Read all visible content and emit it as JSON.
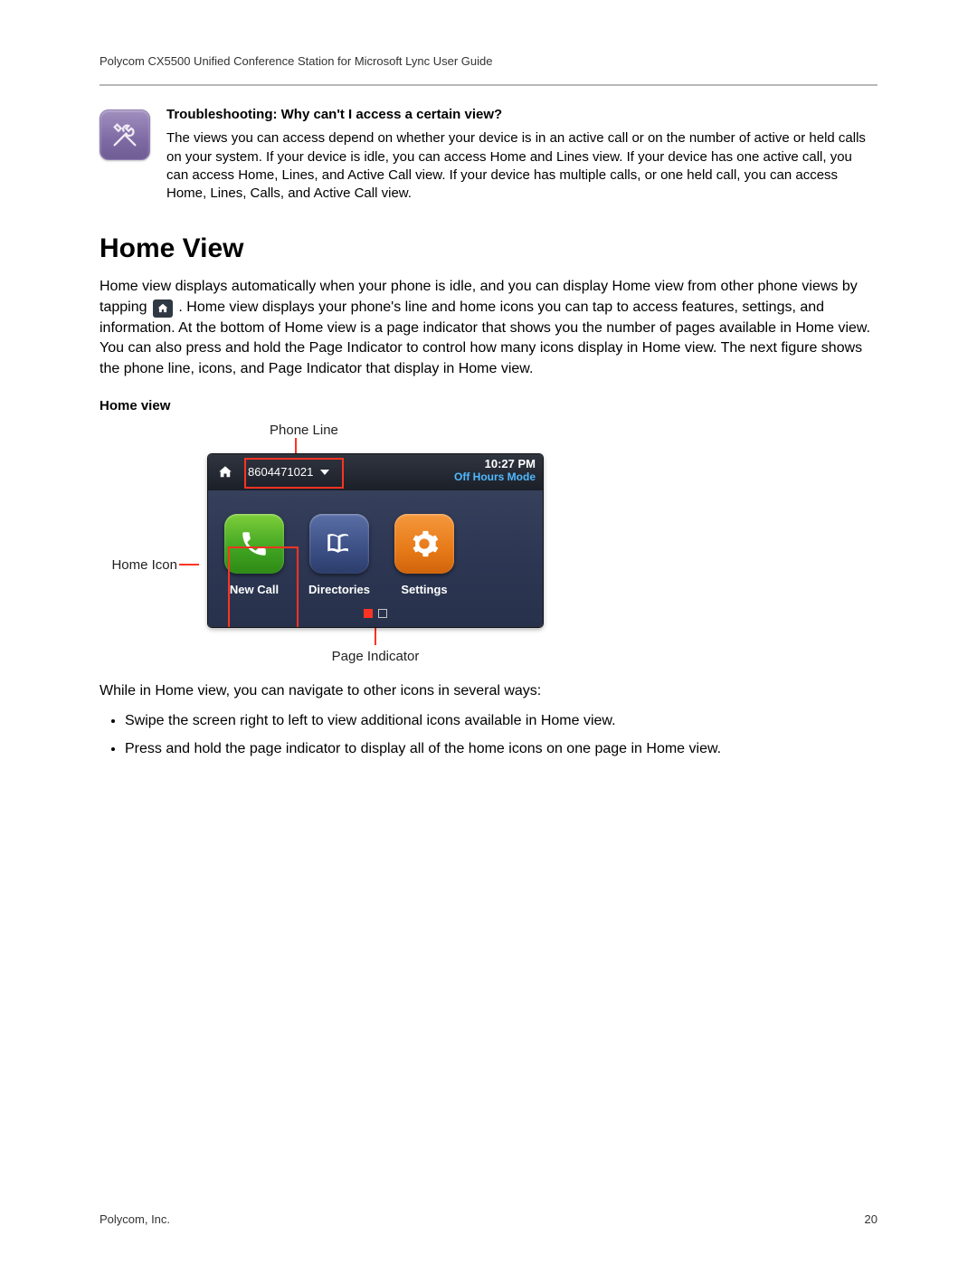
{
  "header": {
    "title": "Polycom CX5500 Unified Conference Station for Microsoft Lync User Guide"
  },
  "note": {
    "title": "Troubleshooting: Why can't I access a certain view?",
    "body": "The views you can access depend on whether your device is in an active call or on the number of active or held calls on your system. If your device is idle, you can access Home and Lines view. If your device has one active call, you can access Home, Lines, and Active Call view. If your device has multiple calls, or one held call, you can access Home, Lines, Calls, and Active Call view."
  },
  "section": {
    "title": "Home View",
    "para_a": "Home view displays automatically when your phone is idle, and you can display Home view from other phone views by tapping ",
    "para_b": ". Home view displays your phone's line and home icons you can tap to access features, settings, and information. At the bottom of Home view is a page indicator that shows you the number of pages available in Home view. You can also press and hold the Page Indicator to control how many icons display in Home view. The next figure shows the phone line, icons, and Page Indicator that display in Home view."
  },
  "figure": {
    "caption": "Home view",
    "callouts": {
      "top": "Phone Line",
      "left": "Home Icon",
      "bottom": "Page Indicator"
    },
    "device": {
      "phone_line": "8604471021",
      "time": "10:27 PM",
      "mode": "Off Hours Mode",
      "tiles": [
        {
          "label": "New Call",
          "color": "green",
          "icon": "phone"
        },
        {
          "label": "Directories",
          "color": "blue",
          "icon": "book"
        },
        {
          "label": "Settings",
          "color": "orange",
          "icon": "gear"
        }
      ],
      "pager": {
        "count": 2,
        "active": 0
      }
    }
  },
  "nav": {
    "intro": "While in Home view, you can navigate to other icons in several ways:",
    "bullets": [
      "Swipe the screen right to left to view additional icons available in Home view.",
      "Press and hold the page indicator to display all of the home icons on one page in Home view."
    ]
  },
  "footer": {
    "company": "Polycom, Inc.",
    "page": "20"
  }
}
